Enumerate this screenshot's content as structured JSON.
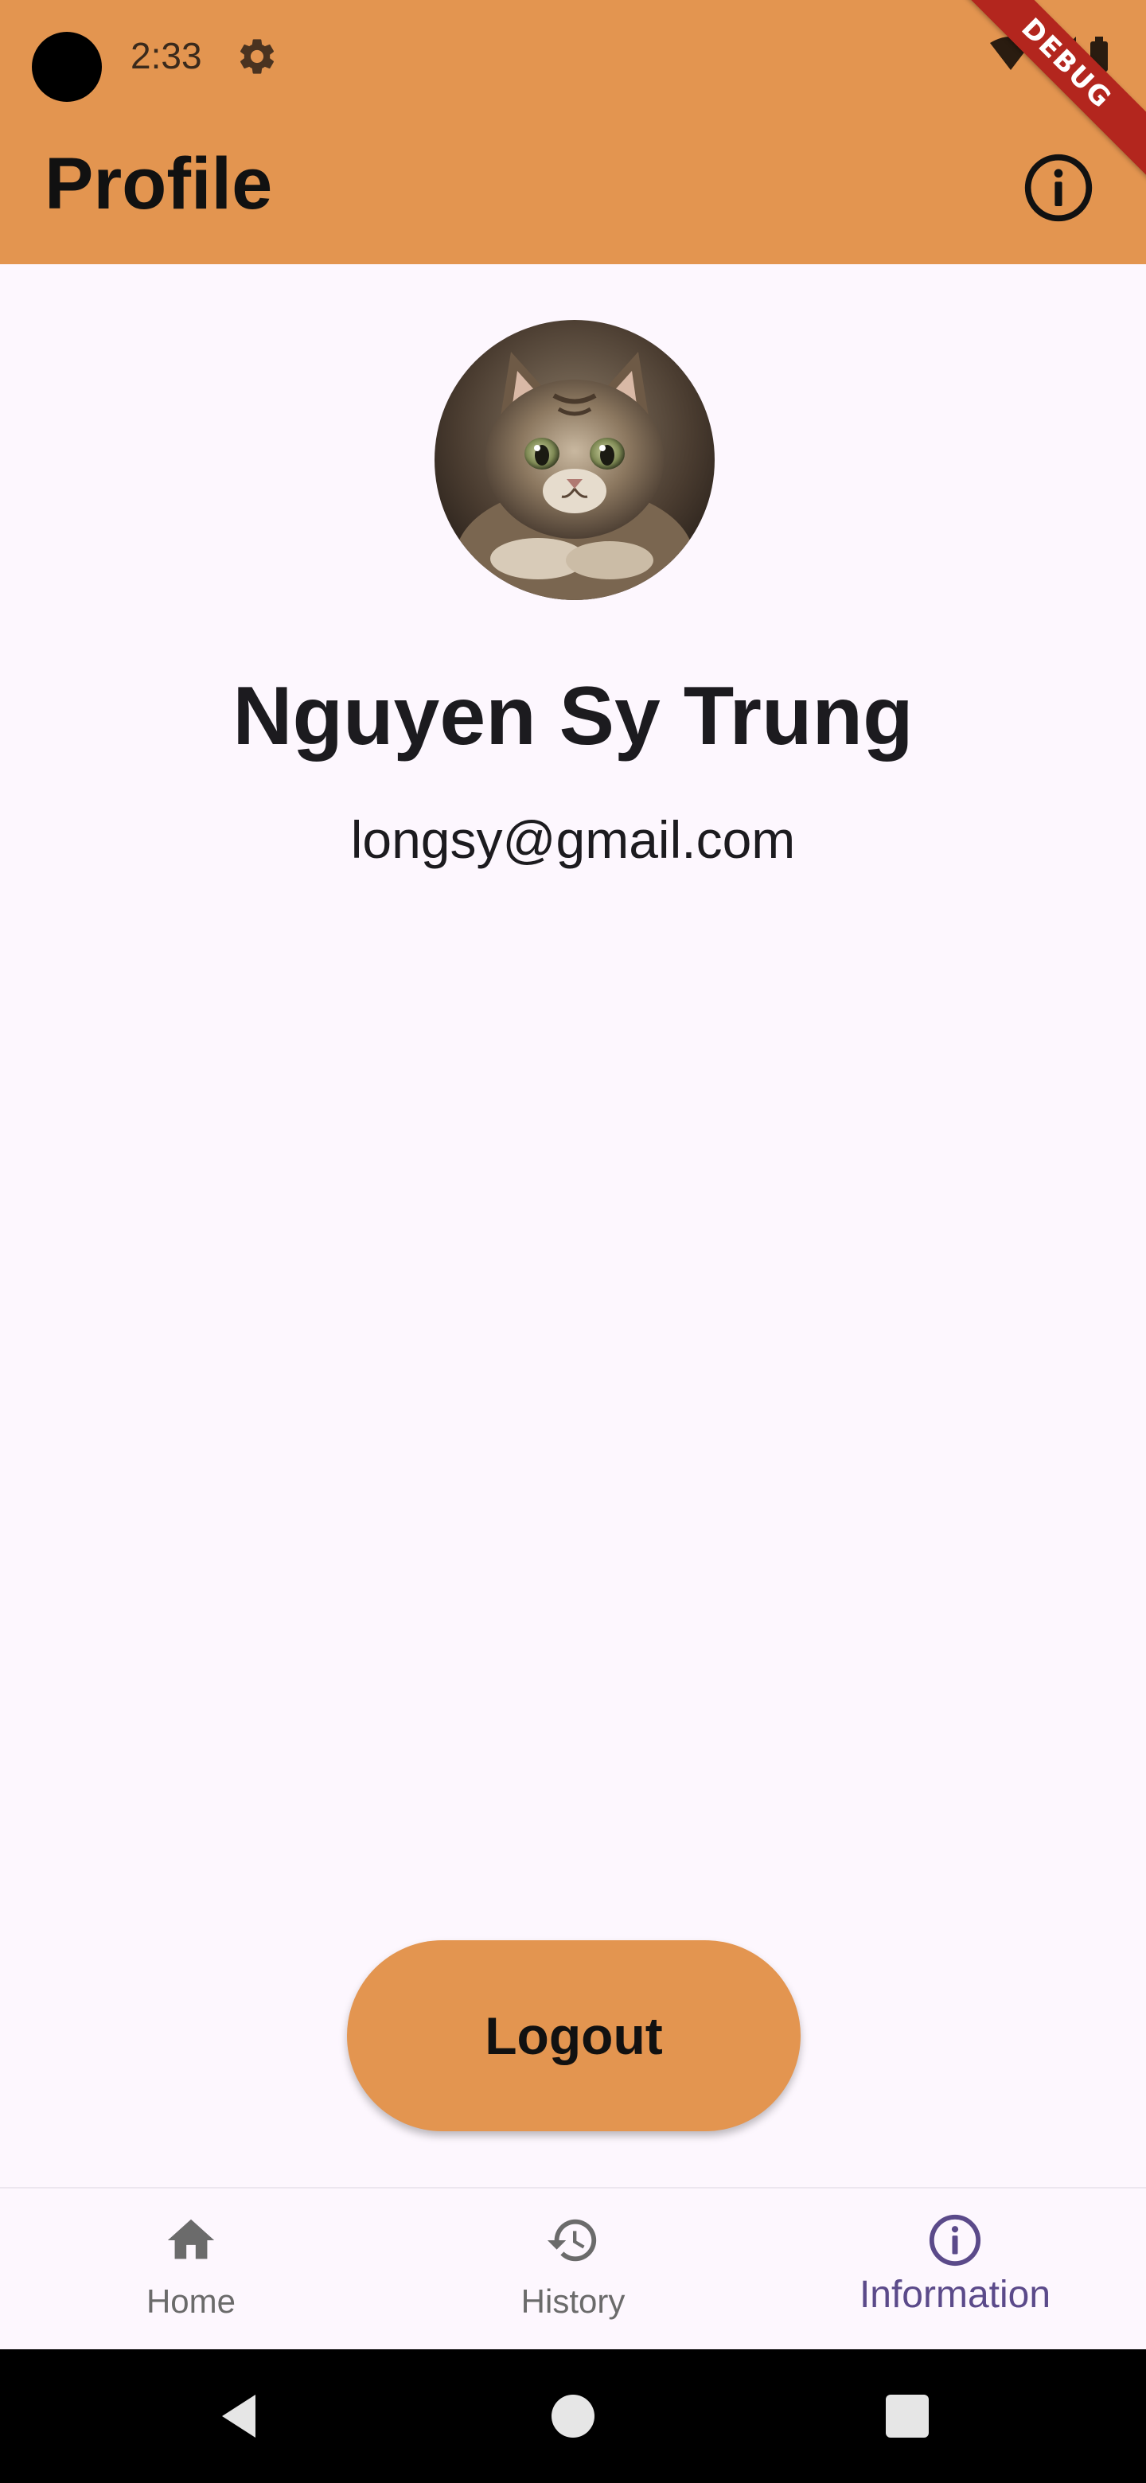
{
  "status_bar": {
    "time": "2:33",
    "icons": [
      "gear-icon",
      "wifi-icon",
      "signal-icon",
      "battery-icon"
    ]
  },
  "debug_banner": {
    "label": "DEBUG"
  },
  "app_bar": {
    "title": "Profile",
    "action_icon": "info-icon",
    "background_color": "#e39550"
  },
  "profile": {
    "avatar": "kitten-avatar",
    "name": "Nguyen Sy Trung",
    "email": "longsy@gmail.com"
  },
  "logout": {
    "label": "Logout",
    "color": "#e39550"
  },
  "bottom_nav": {
    "items": [
      {
        "label": "Home",
        "icon": "home-icon",
        "active": false
      },
      {
        "label": "History",
        "icon": "history-icon",
        "active": false
      },
      {
        "label": "Information",
        "icon": "info-icon",
        "active": true
      }
    ],
    "active_color": "#5b4a8a"
  },
  "system_nav": {
    "buttons": [
      "back-icon",
      "home-circle-icon",
      "recents-icon"
    ]
  }
}
